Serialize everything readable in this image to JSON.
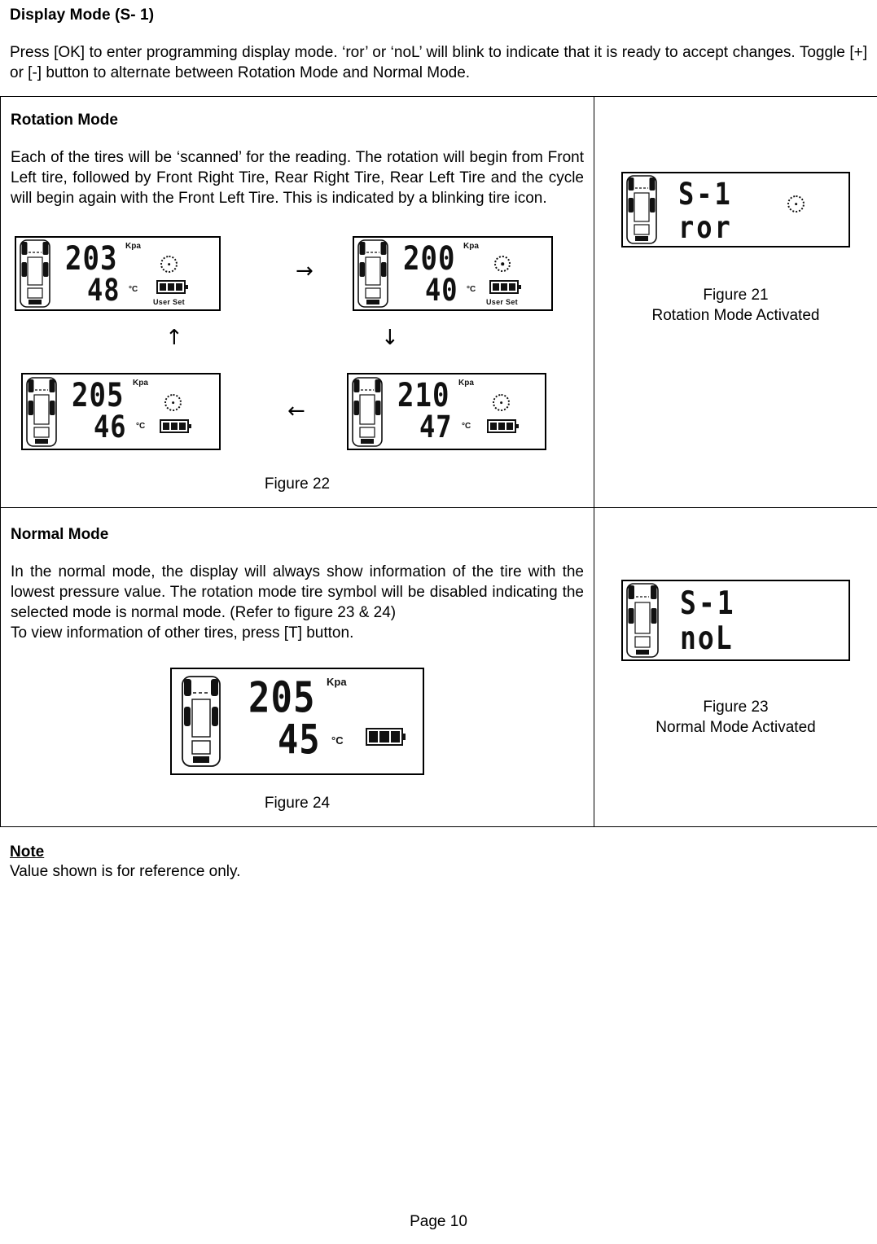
{
  "document": {
    "heading": "Display Mode (S- 1)",
    "intro_paragraph": "Press [OK] to enter programming display mode. ‘ror’ or ‘noL’ will blink to indicate that it is ready to accept changes. Toggle [+] or [-] button to alternate between Rotation Mode and Normal Mode.",
    "page_number": "Page 10"
  },
  "rotation_section": {
    "title": "Rotation Mode",
    "body": "Each of the tires will be ‘scanned’ for the reading. The rotation will begin from Front Left tire, followed by Front Right Tire, Rear Right Tire, Rear Left Tire and the cycle will begin again with the Front Left Tire. This is indicated by a blinking tire icon.",
    "figure_caption": "Figure 22",
    "arrows": {
      "right": "→",
      "up": "↑",
      "down": "↓",
      "left": "←"
    },
    "displays": [
      {
        "id": "display-front-left",
        "pressure": "203",
        "pressure_unit": "Kpa",
        "temperature": "48",
        "temperature_unit": "°C",
        "tire_icon": "tire-rotation-icon",
        "battery_icon": "battery-icon",
        "battery_bars": 3,
        "user_set_label": "User Set"
      },
      {
        "id": "display-front-right",
        "pressure": "200",
        "pressure_unit": "Kpa",
        "temperature": "40",
        "temperature_unit": "°C",
        "tire_icon": "tire-rotation-icon",
        "battery_icon": "battery-icon",
        "battery_bars": 3,
        "user_set_label": "User Set"
      },
      {
        "id": "display-rear-left",
        "pressure": "205",
        "pressure_unit": "Kpa",
        "temperature": "46",
        "temperature_unit": "°C",
        "tire_icon": "tire-rotation-icon",
        "battery_icon": "battery-icon",
        "battery_bars": 3,
        "user_set_label": ""
      },
      {
        "id": "display-rear-right",
        "pressure": "210",
        "pressure_unit": "Kpa",
        "temperature": "47",
        "temperature_unit": "°C",
        "tire_icon": "tire-rotation-icon",
        "battery_icon": "battery-icon",
        "battery_bars": 3,
        "user_set_label": ""
      }
    ]
  },
  "figure21": {
    "line1": "S-1",
    "line2": "ror",
    "tire_icon": "tire-rotation-icon",
    "caption_line1": "Figure 21",
    "caption_line2": "Rotation Mode Activated"
  },
  "normal_section": {
    "title": "Normal Mode",
    "body_paragraph1": "In the normal mode, the display will always show information of the tire with the lowest pressure value. The rotation mode tire symbol will be disabled indicating the selected mode is normal mode. (Refer to figure 23 & 24)",
    "body_paragraph2": "To view information of other tires, press [T] button.",
    "figure_caption": "Figure 24",
    "display": {
      "id": "display-normal-mode",
      "pressure": "205",
      "pressure_unit": "Kpa",
      "temperature": "45",
      "temperature_unit": "°C",
      "battery_icon": "battery-icon",
      "battery_bars": 3
    }
  },
  "figure23": {
    "line1": "S-1",
    "line2": "noL",
    "caption_line1": "Figure 23",
    "caption_line2": "Normal Mode Activated"
  },
  "note": {
    "title": "Note",
    "text": "Value shown is for reference only."
  },
  "colors": {
    "text": "#000000",
    "background": "#ffffff",
    "lcd_segment": "#111111"
  }
}
